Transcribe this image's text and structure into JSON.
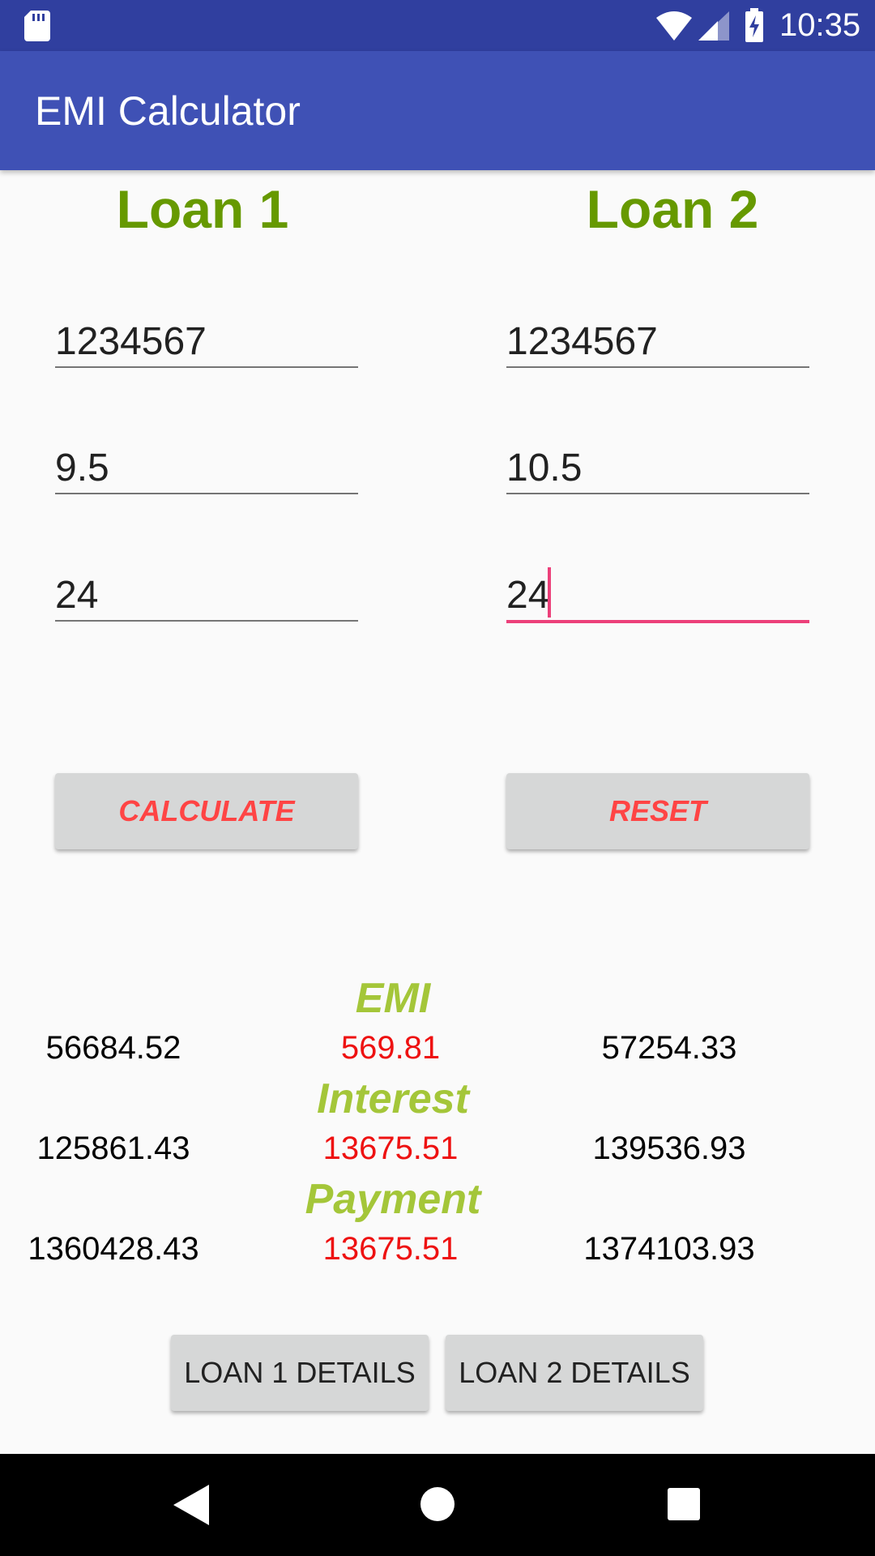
{
  "status_bar": {
    "time": "10:35"
  },
  "app_bar": {
    "title": "EMI Calculator"
  },
  "loan1": {
    "heading": "Loan 1",
    "amount": "1234567",
    "rate": "9.5",
    "tenure": "24"
  },
  "loan2": {
    "heading": "Loan 2",
    "amount": "1234567",
    "rate": "10.5",
    "tenure": "24"
  },
  "buttons": {
    "calculate": "CALCULATE",
    "reset": "RESET",
    "loan1_details": "LOAN 1 DETAILS",
    "loan2_details": "LOAN 2 DETAILS"
  },
  "results": {
    "emi": {
      "label": "EMI",
      "loan1": "56684.52",
      "diff": "569.81",
      "loan2": "57254.33"
    },
    "interest": {
      "label": "Interest",
      "loan1": "125861.43",
      "diff": "13675.51",
      "loan2": "139536.93"
    },
    "payment": {
      "label": "Payment",
      "loan1": "1360428.43",
      "diff": "13675.51",
      "loan2": "1374103.93"
    }
  },
  "colors": {
    "status_bar": "#303f9f",
    "app_bar": "#3f51b5",
    "heading_green": "#669900",
    "label_green": "#a4c639",
    "accent_pink": "#ec407a",
    "button_text_red": "#ff4444",
    "diff_red": "#ee1111"
  },
  "icons": {
    "status": [
      "sd-card-icon",
      "wifi-icon",
      "cell-signal-icon",
      "battery-charging-icon"
    ],
    "nav": [
      "back-icon",
      "home-icon",
      "recent-apps-icon"
    ]
  }
}
